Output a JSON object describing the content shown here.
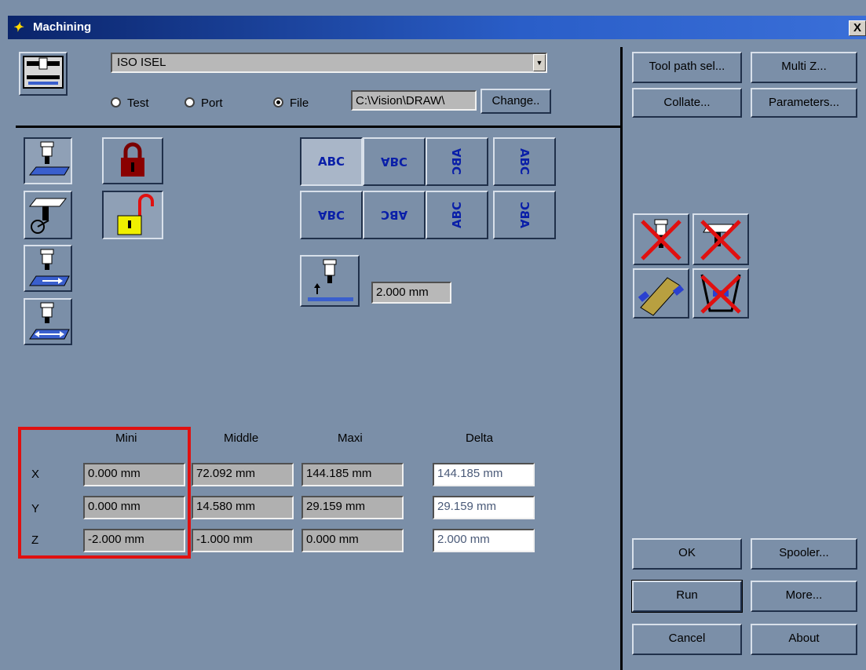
{
  "window": {
    "title": "Machining",
    "close_label": "X"
  },
  "machine": {
    "selected": "ISO ISEL",
    "output_options": [
      "Test",
      "Port",
      "File"
    ],
    "output_selected": "File",
    "file_path": "C:\\Vision\\DRAW\\",
    "change_label": "Change.."
  },
  "depth_value": "2.000 mm",
  "text_orientation_labels": [
    "ABC",
    "ABC",
    "ABC",
    "ABC",
    "ABC",
    "ABC",
    "ABC",
    "ABC"
  ],
  "table": {
    "headers": [
      "Mini",
      "Middle",
      "Maxi",
      "Delta"
    ],
    "rows": [
      {
        "axis": "X",
        "mini": "0.000 mm",
        "middle": "72.092 mm",
        "maxi": "144.185 mm",
        "delta": "144.185 mm"
      },
      {
        "axis": "Y",
        "mini": "0.000 mm",
        "middle": "14.580 mm",
        "maxi": "29.159 mm",
        "delta": "29.159 mm"
      },
      {
        "axis": "Z",
        "mini": "-2.000 mm",
        "middle": "-1.000 mm",
        "maxi": "0.000 mm",
        "delta": "2.000 mm"
      }
    ]
  },
  "right_panel": {
    "tool_path_sel": "Tool path sel...",
    "multi_z": "Multi Z...",
    "collate": "Collate...",
    "parameters": "Parameters...",
    "ok": "OK",
    "spooler": "Spooler...",
    "run": "Run",
    "more": "More...",
    "cancel": "Cancel",
    "about": "About"
  },
  "colors": {
    "background": "#7b8fa8",
    "title_bar": "#0a246a",
    "highlight_box": "#e01010",
    "abc_text": "#0a1fa8"
  }
}
